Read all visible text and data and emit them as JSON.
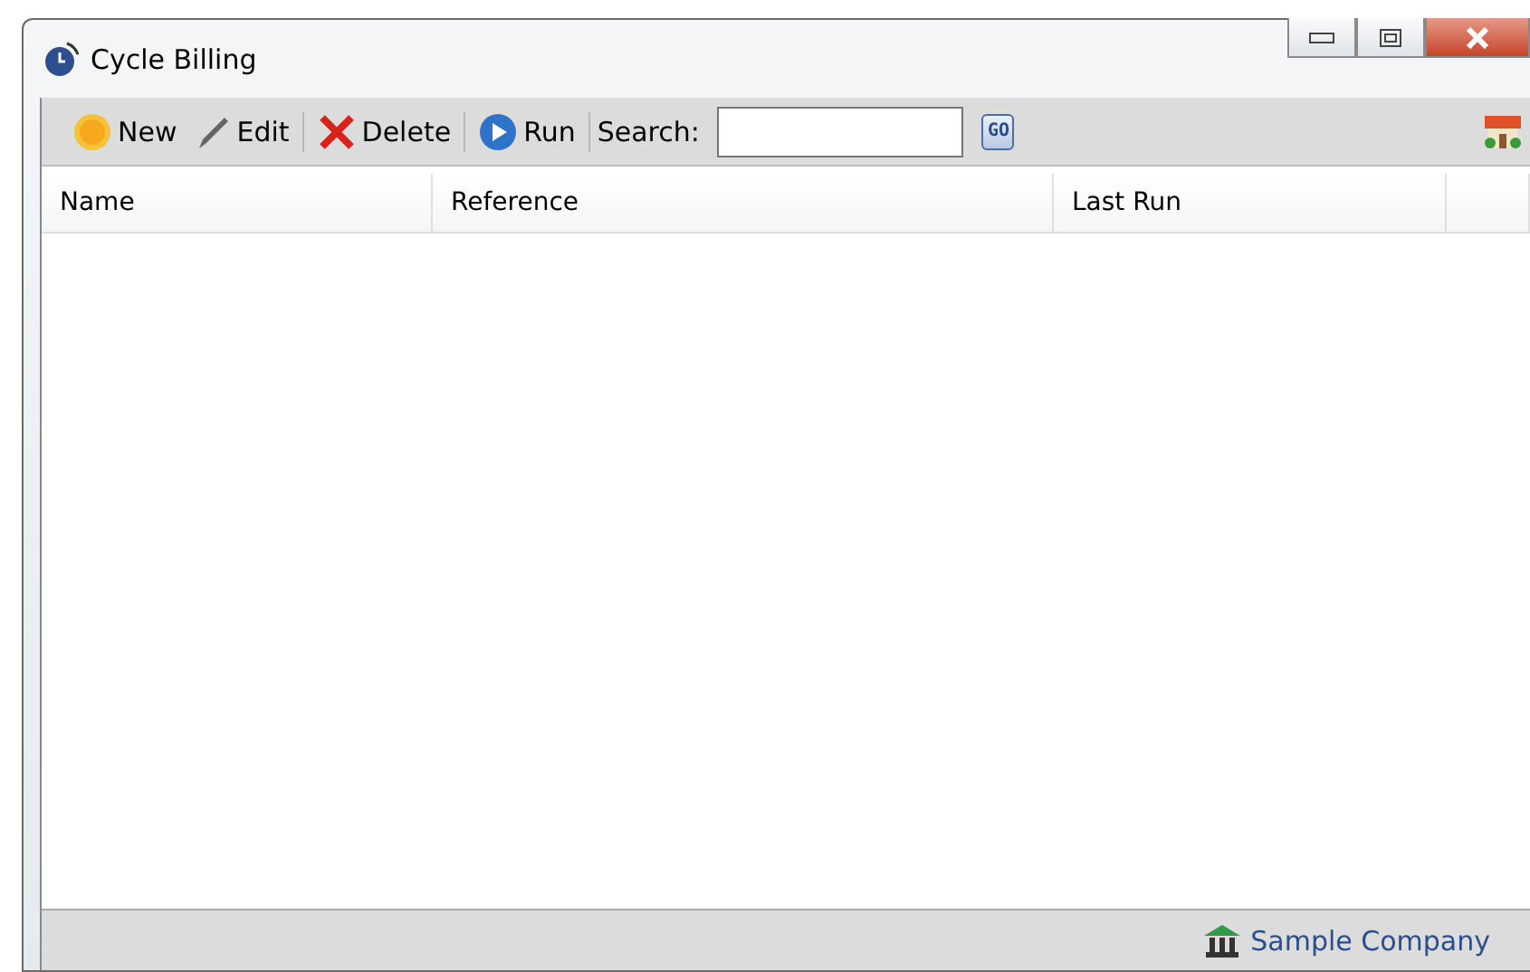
{
  "window": {
    "title": "Cycle Billing"
  },
  "toolbar": {
    "buttons": [
      {
        "kind": "new",
        "label": "New"
      },
      {
        "kind": "edit",
        "label": "Edit"
      },
      {
        "kind": "delete",
        "label": "Delete"
      },
      {
        "kind": "run",
        "label": "Run"
      }
    ],
    "search_label": "Search:",
    "go_label": "GO"
  },
  "table": {
    "columns": [
      "Name",
      "Reference",
      "Last Run"
    ]
  },
  "status_bar": {
    "company": "Sample Company"
  }
}
